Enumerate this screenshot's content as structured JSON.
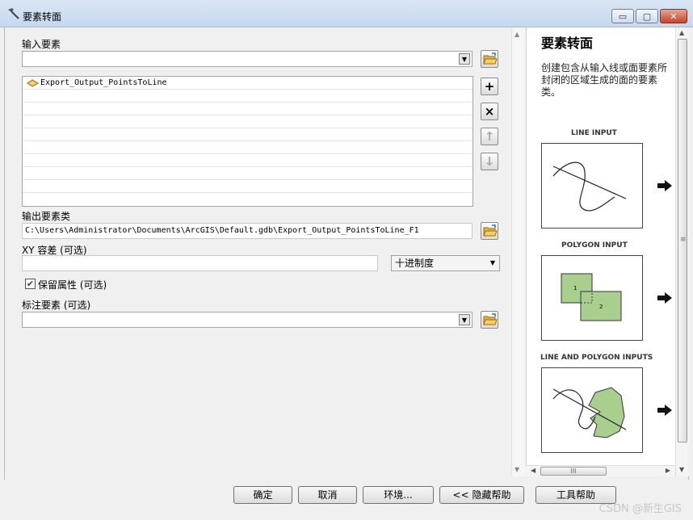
{
  "window": {
    "title": "要素转面",
    "icon": "hammer-icon",
    "controls": {
      "minimize": "▭",
      "maximize": "▢",
      "close": "✕"
    }
  },
  "form": {
    "input_features_label": "输入要素",
    "input_features_value": "",
    "input_list": [
      "Export_Output_PointsToLine"
    ],
    "output_class_label": "输出要素类",
    "output_class_value": "C:\\Users\\Administrator\\Documents\\ArcGIS\\Default.gdb\\Export_Output_PointsToLine_F1",
    "xy_tolerance_label": "XY 容差 (可选)",
    "xy_tolerance_value": "",
    "xy_unit_value": "十进制度",
    "preserve_attributes_label": "保留属性 (可选)",
    "preserve_attributes_checked": true,
    "label_features_label": "标注要素 (可选)",
    "label_features_value": ""
  },
  "side_buttons": {
    "add": "+",
    "remove": "×",
    "up": "↑",
    "down": "↓"
  },
  "help": {
    "title": "要素转面",
    "description": "创建包含从输入线或面要素所封闭的区域生成的面的要素类。",
    "figures": [
      {
        "caption": "LINE INPUT"
      },
      {
        "caption": "POLYGON INPUT",
        "labels": [
          "1",
          "2"
        ]
      },
      {
        "caption": "LINE AND POLYGON INPUTS"
      }
    ],
    "scroll_grip": "≡",
    "hscroll_grip": "III"
  },
  "buttons": {
    "ok": "确定",
    "cancel": "取消",
    "environments": "环境...",
    "hide_help": "<< 隐藏帮助",
    "tool_help": "工具帮助"
  },
  "watermark": "CSDN @新生GIS",
  "colors": {
    "polygon_fill": "#a9cf8f",
    "titlebar": "#c5d8ef",
    "close_button": "#c3452c"
  }
}
